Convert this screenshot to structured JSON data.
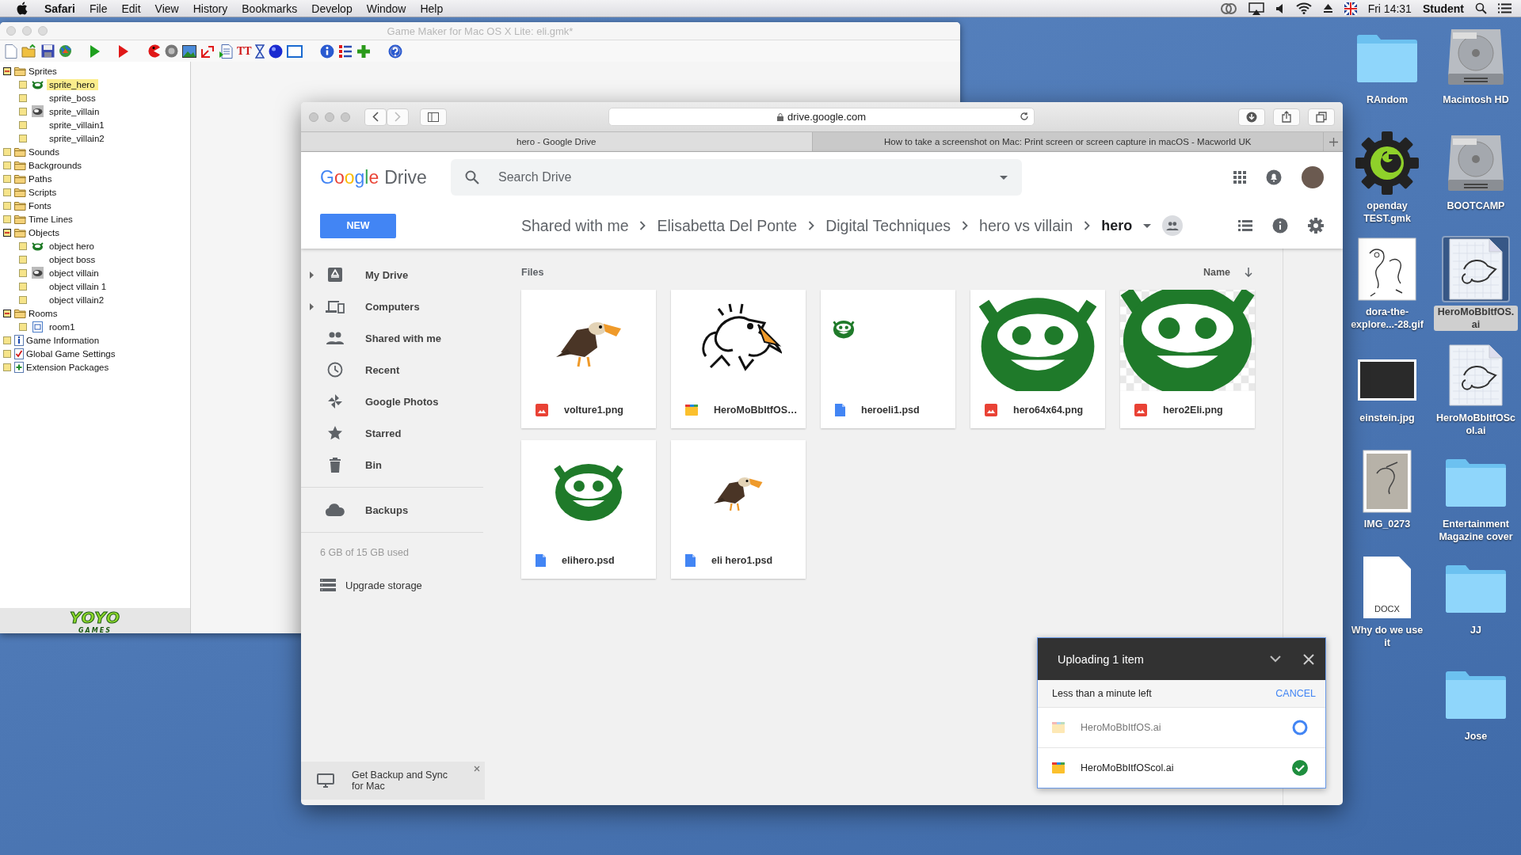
{
  "menu_bar": {
    "app": "Safari",
    "menus": [
      "File",
      "Edit",
      "View",
      "History",
      "Bookmarks",
      "Develop",
      "Window",
      "Help"
    ],
    "clock": "Fri 14:31",
    "user": "Student"
  },
  "gamemaker": {
    "title": "Game Maker for Mac OS X Lite: eli.gmk*",
    "font_tool_text": "TT",
    "tree": [
      {
        "label": "Sprites",
        "kind": "folder",
        "expanded": true,
        "children": [
          {
            "label": "sprite_hero",
            "kind": "hero",
            "selected": true
          },
          {
            "label": "sprite_boss",
            "kind": "plain",
            "selected": false
          },
          {
            "label": "sprite_villain",
            "kind": "villain",
            "selected": false
          },
          {
            "label": "sprite_villain1",
            "kind": "plain",
            "selected": false
          },
          {
            "label": "sprite_villain2",
            "kind": "plain",
            "selected": false
          }
        ]
      },
      {
        "label": "Sounds",
        "kind": "folder",
        "expanded": false
      },
      {
        "label": "Backgrounds",
        "kind": "folder",
        "expanded": false
      },
      {
        "label": "Paths",
        "kind": "folder",
        "expanded": false
      },
      {
        "label": "Scripts",
        "kind": "folder",
        "expanded": false
      },
      {
        "label": "Fonts",
        "kind": "folder",
        "expanded": false
      },
      {
        "label": "Time Lines",
        "kind": "folder",
        "expanded": false
      },
      {
        "label": "Objects",
        "kind": "folder",
        "expanded": true,
        "children": [
          {
            "label": "object hero",
            "kind": "hero",
            "selected": false
          },
          {
            "label": "object boss",
            "kind": "plain",
            "selected": false
          },
          {
            "label": "object villain",
            "kind": "villain",
            "selected": false
          },
          {
            "label": "object villain 1",
            "kind": "plain",
            "selected": false
          },
          {
            "label": "object villain2",
            "kind": "plain",
            "selected": false
          }
        ]
      },
      {
        "label": "Rooms",
        "kind": "folder",
        "expanded": true,
        "children": [
          {
            "label": "room1",
            "kind": "room",
            "selected": false
          }
        ]
      },
      {
        "label": "Game Information",
        "kind": "info",
        "expanded": false
      },
      {
        "label": "Global Game Settings",
        "kind": "settings",
        "expanded": false
      },
      {
        "label": "Extension Packages",
        "kind": "extension",
        "expanded": false
      }
    ],
    "logo": [
      "YOYO",
      "GAMES"
    ]
  },
  "safari": {
    "address": "drive.google.com",
    "tabs": [
      {
        "label": "hero - Google Drive",
        "selected": true
      },
      {
        "label": "How to take a screenshot on Mac: Print screen or screen capture in macOS - Macworld UK",
        "selected": false
      }
    ]
  },
  "drive": {
    "logo": "Google",
    "product": "Drive",
    "search": {
      "placeholder": "Search Drive"
    },
    "new_button": "NEW",
    "breadcrumbs": [
      {
        "label": "Shared with me",
        "current": false
      },
      {
        "label": "Elisabetta Del Ponte",
        "current": false
      },
      {
        "label": "Digital Techniques",
        "current": false
      },
      {
        "label": "hero vs villain",
        "current": false
      },
      {
        "label": "hero",
        "current": true
      }
    ],
    "nav": [
      {
        "label": "My Drive",
        "kind": "drive",
        "expandable": true
      },
      {
        "label": "Computers",
        "kind": "computers",
        "expandable": true
      },
      {
        "label": "Shared with me",
        "kind": "shared",
        "expandable": false
      },
      {
        "label": "Recent",
        "kind": "recent",
        "expandable": false
      },
      {
        "label": "Google Photos",
        "kind": "photos",
        "expandable": false
      },
      {
        "label": "Starred",
        "kind": "starred",
        "expandable": false
      },
      {
        "label": "Bin",
        "kind": "bin",
        "expandable": false
      }
    ],
    "backups": "Backups",
    "storage": "6 GB of 15 GB used",
    "upgrade": "Upgrade storage",
    "promo": "Get Backup and Sync for Mac",
    "files_heading": "Files",
    "sort": "Name",
    "files": [
      {
        "name": "volture1.png",
        "kind": "image",
        "thumbnail": {
          "kind": "vulture"
        }
      },
      {
        "name": "HeroMoBbItfOS…",
        "kind": "ai",
        "thumbnail": {
          "kind": "sketch"
        }
      },
      {
        "name": "heroeli1.psd",
        "kind": "doc",
        "thumbnail": {
          "kind": "face-small"
        }
      },
      {
        "name": "hero64x64.png",
        "kind": "image",
        "thumbnail": {
          "kind": "face-crop"
        }
      },
      {
        "name": "hero2Eli.png",
        "kind": "image",
        "thumbnail": {
          "kind": "face-large"
        }
      },
      {
        "name": "elihero.psd",
        "kind": "doc",
        "thumbnail": {
          "kind": "face-full"
        }
      },
      {
        "name": "eli hero1.psd",
        "kind": "doc",
        "thumbnail": {
          "kind": "vulture-small"
        }
      }
    ],
    "upload": {
      "title": "Uploading 1 item",
      "status": "Less than a minute left",
      "cancel": "CANCEL",
      "items": [
        {
          "name": "HeroMoBbItfOS.ai",
          "done": false
        },
        {
          "name": "HeroMoBbItfOScol.ai",
          "done": true
        }
      ]
    }
  },
  "desktop": {
    "columns": [
      [
        {
          "label": "RAndom",
          "kind": "folder",
          "selected": false
        },
        {
          "label": "openday TEST.gmk",
          "kind": "gmk",
          "selected": false
        },
        {
          "label": "dora-the-explore...-28.gif",
          "kind": "sketch",
          "selected": false
        },
        {
          "label": "einstein.jpg",
          "kind": "photo",
          "selected": false
        },
        {
          "label": "IMG_0273",
          "kind": "scan",
          "selected": false
        },
        {
          "label": "Why do we use it",
          "kind": "docx",
          "badge": "DOCX",
          "selected": false
        }
      ],
      [
        {
          "label": "Macintosh HD",
          "kind": "disk",
          "selected": false
        },
        {
          "label": "BOOTCAMP",
          "kind": "disk",
          "selected": false
        },
        {
          "label": "HeroMoBbItfOS.ai",
          "kind": "ai",
          "selected": true
        },
        {
          "label": "HeroMoBbItfOScol.ai",
          "kind": "ai",
          "selected": false
        },
        {
          "label": "Entertainment Magazine cover",
          "kind": "folder",
          "selected": false
        },
        {
          "label": "JJ",
          "kind": "folder",
          "selected": false
        },
        {
          "label": "Jose",
          "kind": "folder",
          "selected": false
        }
      ]
    ]
  }
}
